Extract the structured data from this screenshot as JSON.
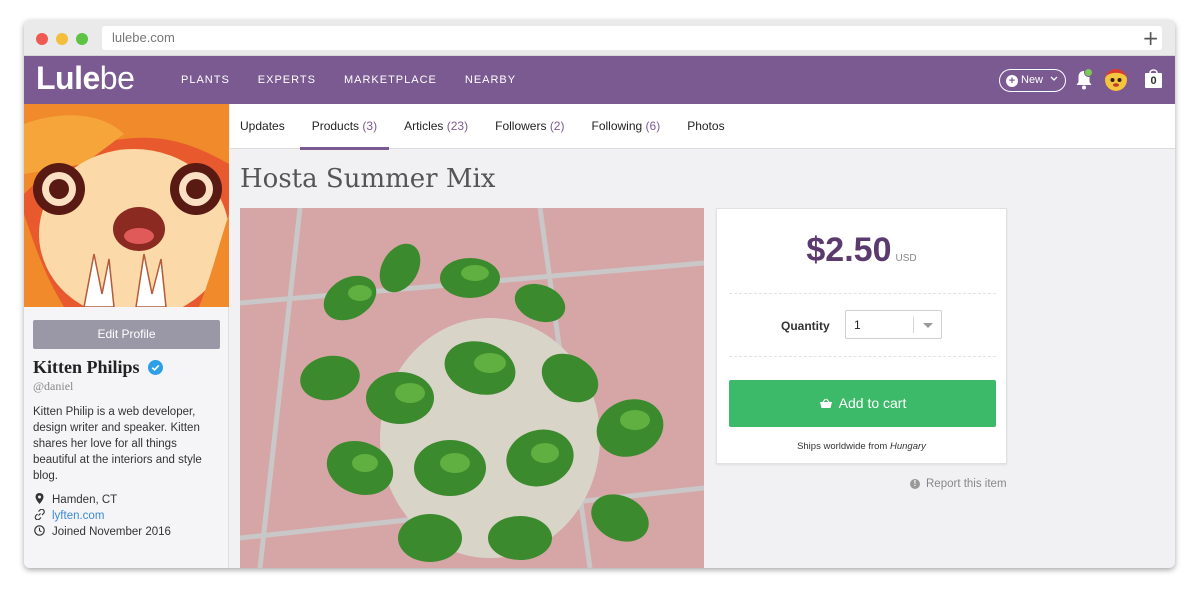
{
  "browser": {
    "url": "lulebe.com",
    "new_tab_symbol": "+"
  },
  "nav": {
    "logo_bold": "Lule",
    "logo_thin": "be",
    "links": [
      "PLANTS",
      "EXPERTS",
      "MARKETPLACE",
      "NEARBY"
    ],
    "new_label": "New",
    "cart_count": "0",
    "accent_color": "#7b5a92"
  },
  "profile": {
    "edit_label": "Edit Profile",
    "name": "Kitten Philips",
    "handle": "@daniel",
    "bio": "Kitten Philip is a web developer, design writer and speaker. Kitten shares her love for all things beautiful at the interiors and style blog.",
    "location": "Hamden, CT",
    "website": "lyften.com",
    "joined": "Joined November 2016"
  },
  "tabs": [
    {
      "label": "Updates",
      "count": ""
    },
    {
      "label": "Products",
      "count": "(3)"
    },
    {
      "label": "Articles",
      "count": "(23)"
    },
    {
      "label": "Followers",
      "count": "(2)"
    },
    {
      "label": "Following",
      "count": "(6)"
    },
    {
      "label": "Photos",
      "count": ""
    }
  ],
  "product": {
    "title": "Hosta Summer Mix",
    "price": "$2.50",
    "currency": "USD",
    "quantity_label": "Quantity",
    "quantity_value": "1",
    "add_to_cart": "Add to cart",
    "ships_prefix": "Ships worldwide from",
    "ships_from": "Hungary",
    "report": "Report this item",
    "cart_button_color": "#3dba69"
  }
}
